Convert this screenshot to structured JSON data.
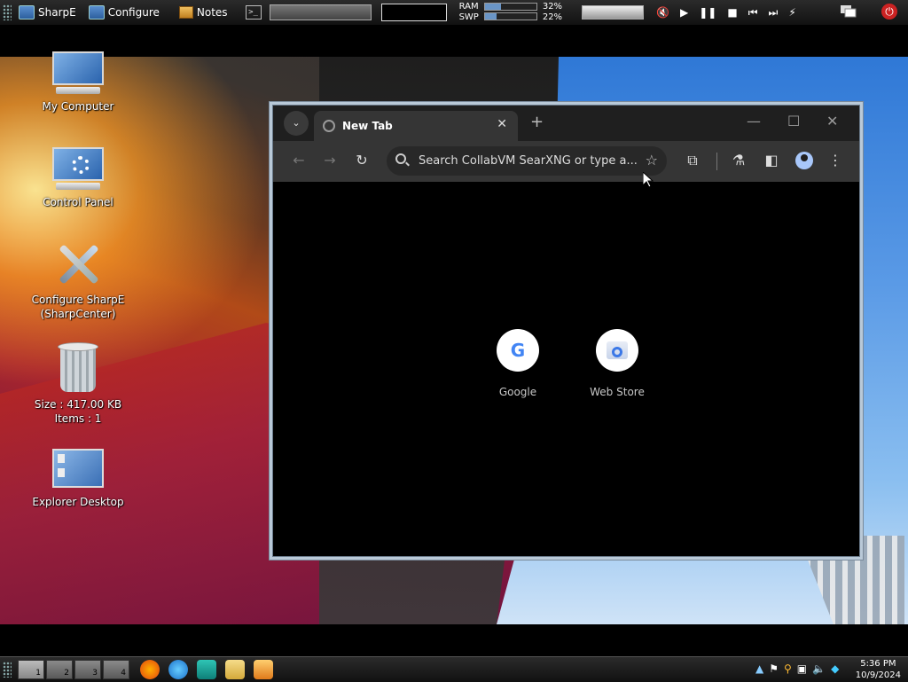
{
  "top_panel": {
    "menus": [
      {
        "label": "SharpE",
        "icon": "monitor-icon"
      },
      {
        "label": "Configure",
        "icon": "monitor-icon"
      },
      {
        "label": "Notes",
        "icon": "notes-icon"
      }
    ],
    "memory": {
      "ram_label": "RAM",
      "ram_pct": "32%",
      "ram_value": 0.32,
      "swp_label": "SWP",
      "swp_pct": "22%",
      "swp_value": 0.22
    }
  },
  "desktop_icons": [
    {
      "name": "my-computer",
      "label": "My Computer"
    },
    {
      "name": "control-panel",
      "label": "Control Panel"
    },
    {
      "name": "configure-sharpe",
      "label": "Configure SharpE",
      "label2": "(SharpCenter)"
    },
    {
      "name": "recycle-bin",
      "label": "Size : 417.00 KB",
      "label2": "Items : 1"
    },
    {
      "name": "explorer-desktop",
      "label": "Explorer Desktop"
    }
  ],
  "browser": {
    "tab_title": "New Tab",
    "omnibox_placeholder": "Search CollabVM SearXNG or type a...",
    "shortcuts": [
      {
        "label": "Google",
        "icon": "google-icon"
      },
      {
        "label": "Web Store",
        "icon": "web-store-icon"
      }
    ]
  },
  "taskbar": {
    "workspaces": [
      "1",
      "2",
      "3",
      "4"
    ],
    "clock_time": "5:36 PM",
    "clock_date": "10/9/2024"
  },
  "colors": {
    "accent": "#6a95c6",
    "chrome_dark": "#1f1f1f",
    "chrome_toolbar": "#353535",
    "power_red": "#cc2222"
  }
}
